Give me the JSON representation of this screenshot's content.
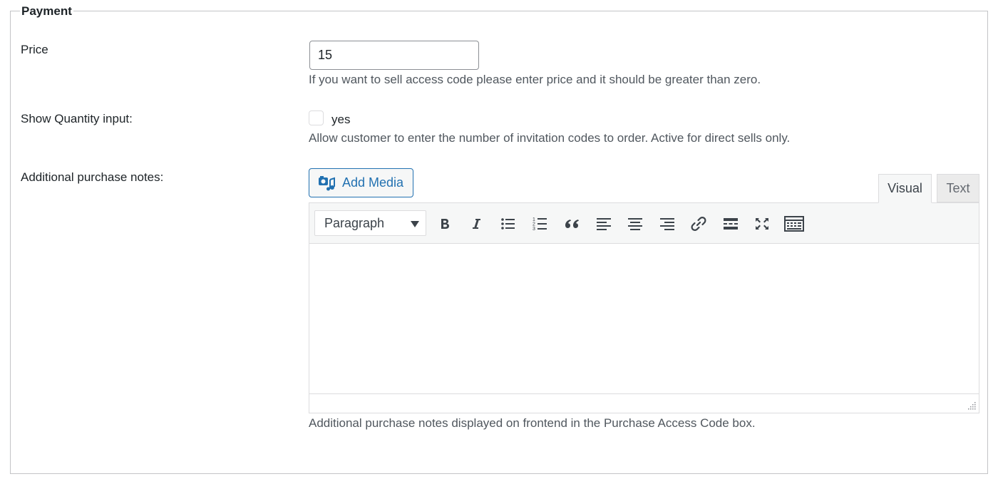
{
  "section": {
    "legend": "Payment"
  },
  "price": {
    "label": "Price",
    "value": "15",
    "description": "If you want to sell access code please enter price and it should be greater than zero."
  },
  "quantity": {
    "label": "Show Quantity input:",
    "checkbox_label": "yes",
    "checked": false,
    "description": "Allow customer to enter the number of invitation codes to order. Active for direct sells only."
  },
  "notes": {
    "label": "Additional purchase notes:",
    "add_media_label": "Add Media",
    "tabs": {
      "visual": "Visual",
      "text": "Text",
      "active": "Visual"
    },
    "format_select": "Paragraph",
    "toolbar_icons": [
      "bold-icon",
      "italic-icon",
      "bullet-list-icon",
      "numbered-list-icon",
      "blockquote-icon",
      "align-left-icon",
      "align-center-icon",
      "align-right-icon",
      "link-icon",
      "read-more-icon",
      "fullscreen-icon",
      "toolbar-toggle-icon"
    ],
    "content": "",
    "description": "Additional purchase notes displayed on frontend in the Purchase Access Code box."
  },
  "colors": {
    "accent": "#2271b1",
    "text": "#1d2327",
    "muted": "#50575e",
    "border": "#dcdcde"
  }
}
